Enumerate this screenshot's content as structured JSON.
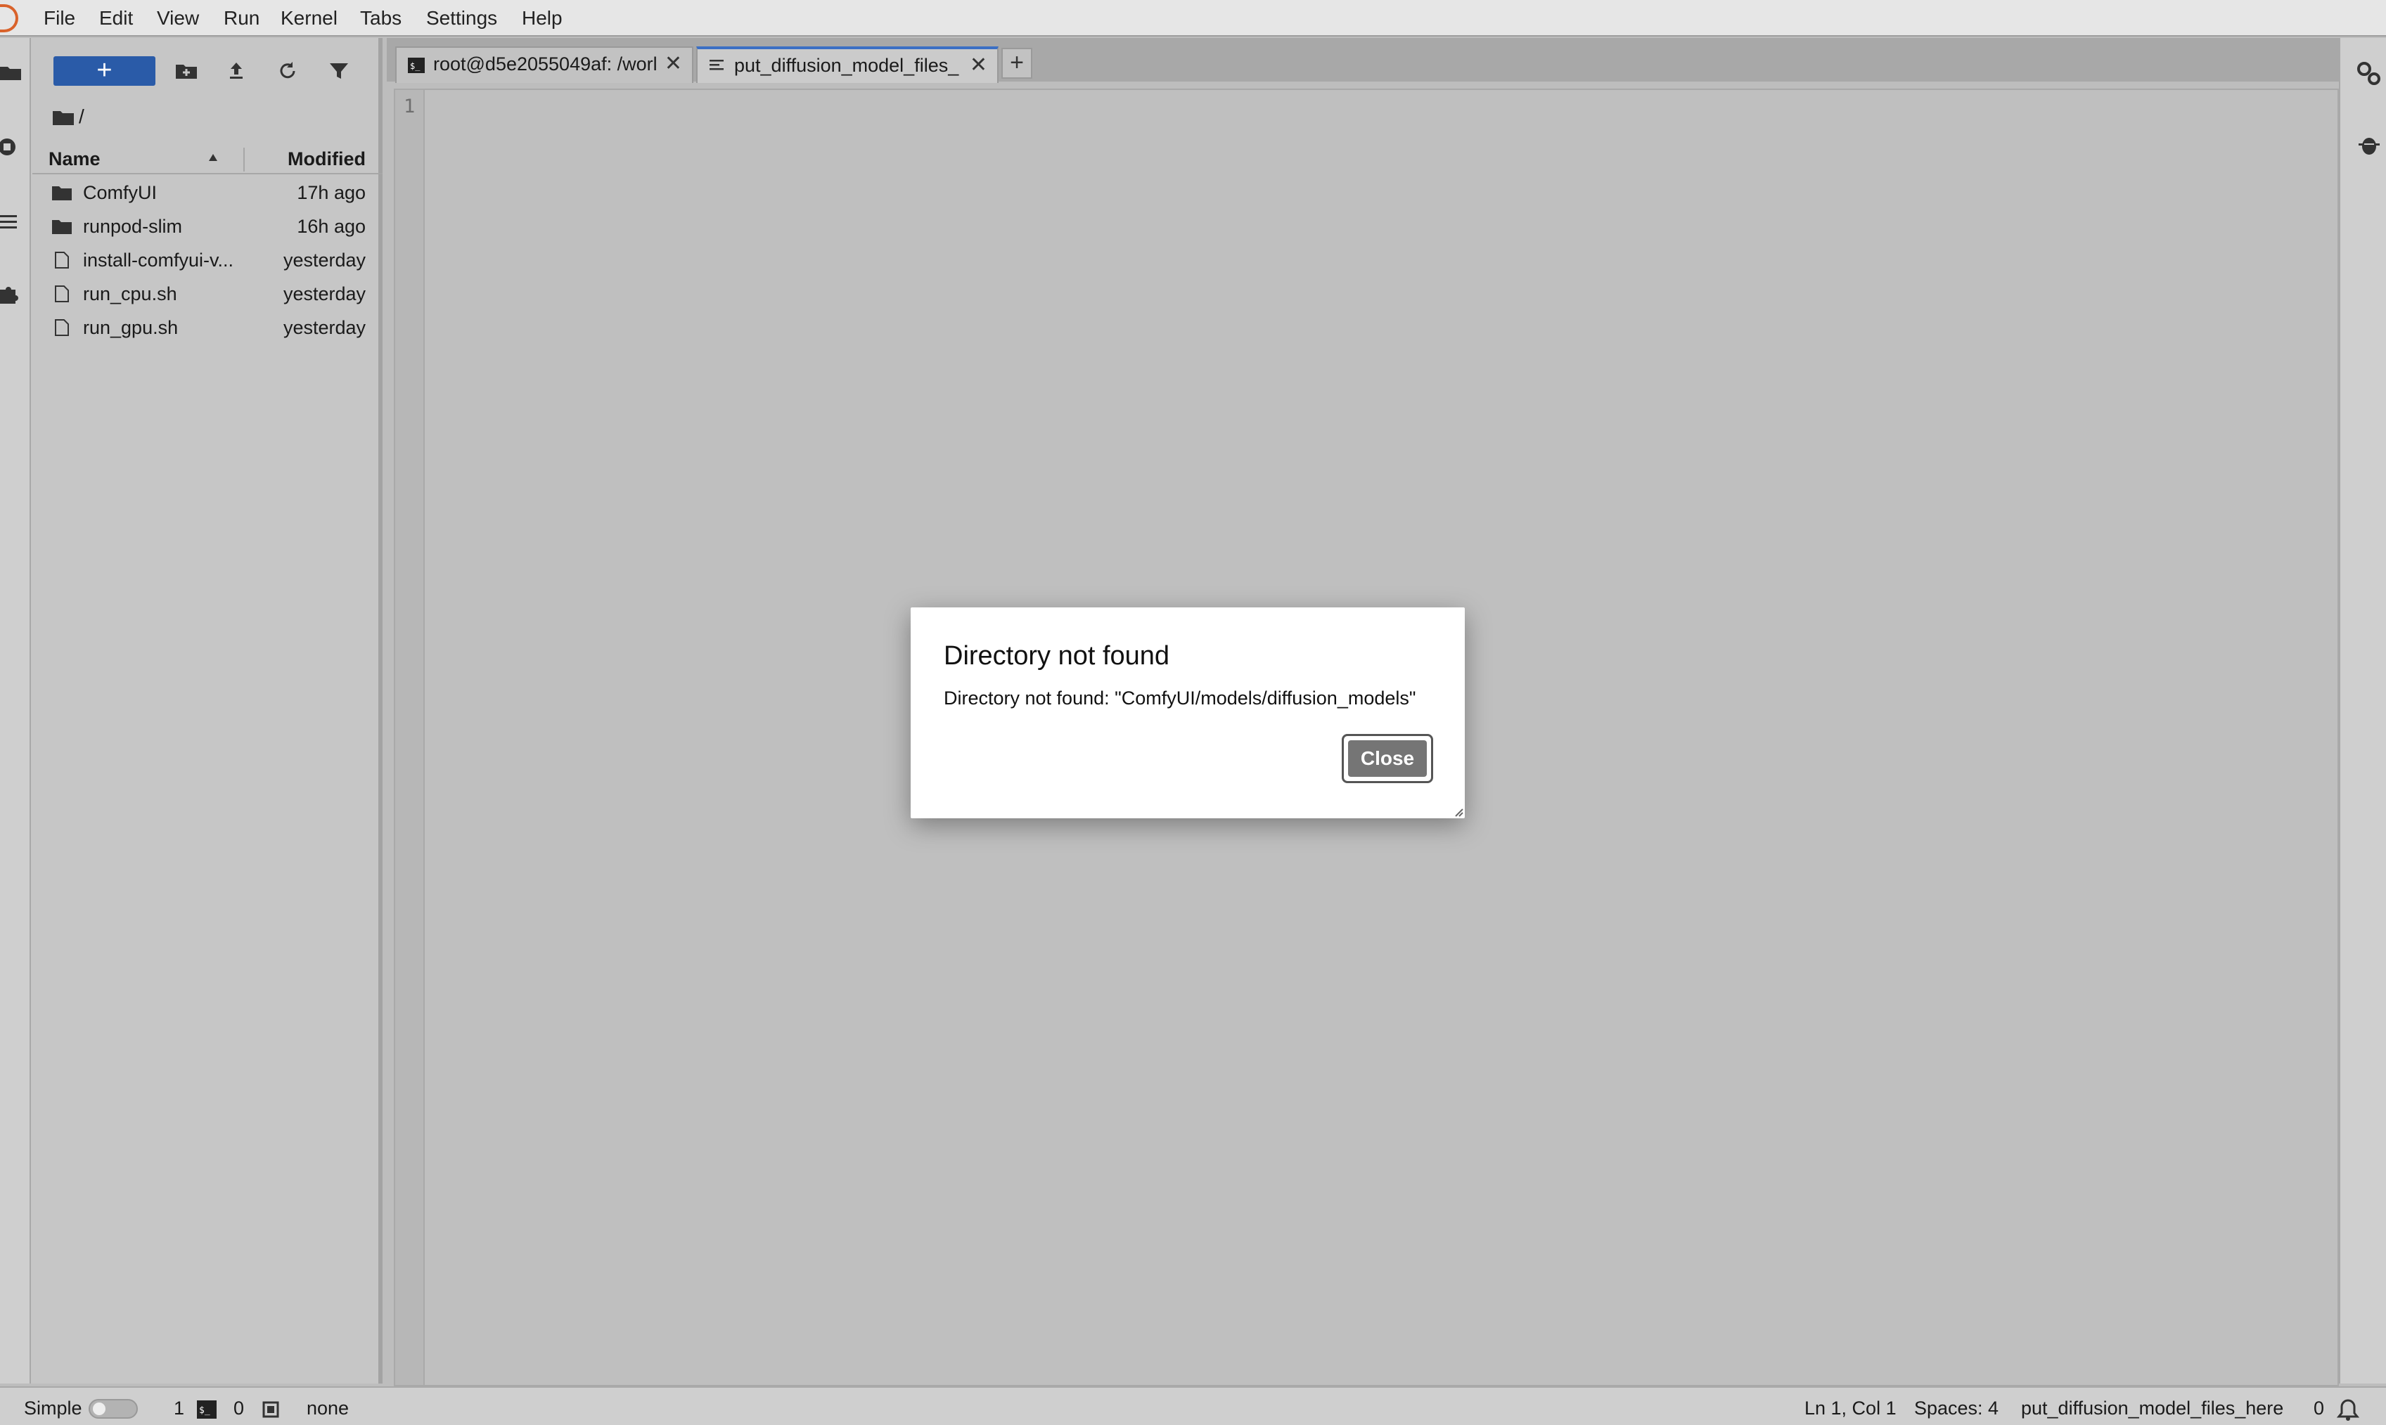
{
  "menubar": {
    "items": [
      "File",
      "Edit",
      "View",
      "Run",
      "Kernel",
      "Tabs",
      "Settings",
      "Help"
    ]
  },
  "filebrowser": {
    "new_label": "+",
    "breadcrumb": "/",
    "columns": {
      "name": "Name",
      "modified": "Modified"
    },
    "rows": [
      {
        "name": "ComfyUI",
        "modified": "17h ago",
        "type": "folder"
      },
      {
        "name": "runpod-slim",
        "modified": "16h ago",
        "type": "folder"
      },
      {
        "name": "install-comfyui-v...",
        "modified": "yesterday",
        "type": "file"
      },
      {
        "name": "run_cpu.sh",
        "modified": "yesterday",
        "type": "file"
      },
      {
        "name": "run_gpu.sh",
        "modified": "yesterday",
        "type": "file"
      }
    ]
  },
  "tabs": [
    {
      "label": "root@d5e2055049af: /worl",
      "icon": "terminal-icon",
      "active": false
    },
    {
      "label": "put_diffusion_model_files_",
      "icon": "text-file-icon",
      "active": true
    }
  ],
  "new_tab_label": "+",
  "editor": {
    "line_number": "1"
  },
  "dialog": {
    "title": "Directory not found",
    "message": "Directory not found: \"ComfyUI/models/diffusion_models\"",
    "close_label": "Close"
  },
  "statusbar": {
    "mode_label": "Simple",
    "terminals_count": "1",
    "kernels_count": "0",
    "kernel_name": "none",
    "cursor": "Ln 1, Col 1",
    "spaces": "Spaces: 4",
    "filename": "put_diffusion_model_files_here",
    "notifications": "0"
  },
  "colors": {
    "accent": "#2a5ba8",
    "logo": "#d9622b",
    "tab_active": "#3b6fc4"
  }
}
